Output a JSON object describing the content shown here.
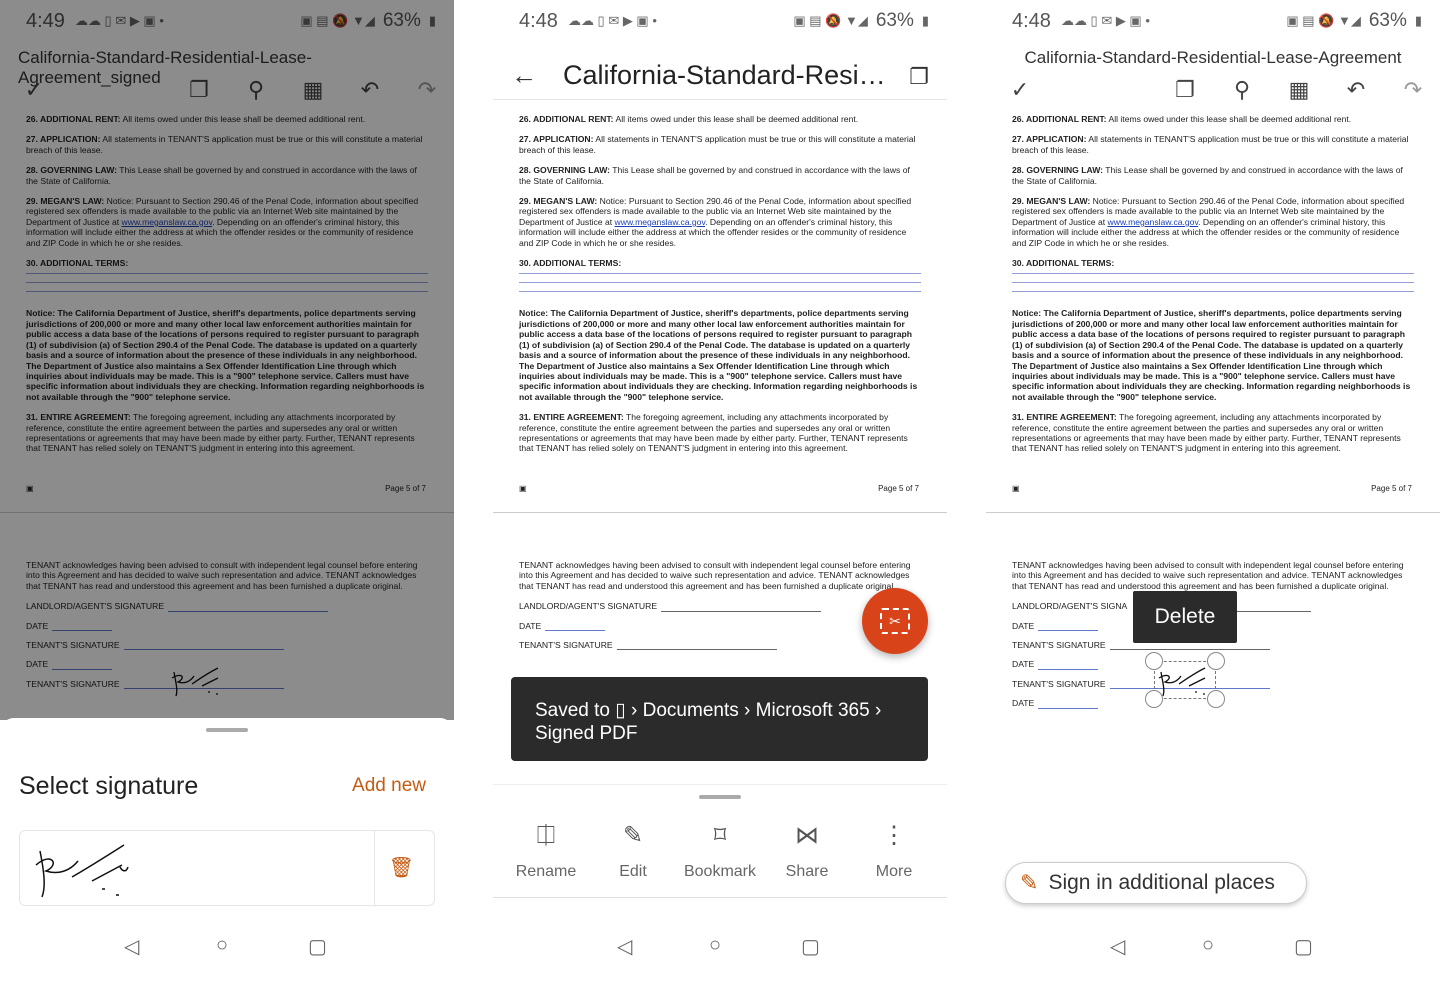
{
  "status": {
    "panel1_time": "4:49",
    "panel2_time": "4:48",
    "panel3_time": "4:48",
    "battery": "63%"
  },
  "panel1": {
    "title": "California-Standard-Residential-Lease-Agreement_signed",
    "sheet_title": "Select signature",
    "add_new": "Add new"
  },
  "panel2": {
    "title": "California-Standard-Resi…",
    "toast_line1": "Saved to",
    "toast_path": "› Documents › Microsoft 365 ›",
    "toast_line2": "Signed PDF",
    "actions": [
      "Rename",
      "Edit",
      "Bookmark",
      "Share",
      "More"
    ]
  },
  "panel3": {
    "title": "California-Standard-Residential-Lease-Agreement",
    "delete_label": "Delete",
    "sign_more": "Sign in additional places"
  },
  "doc": {
    "c26_h": "26. ADDITIONAL RENT:",
    "c26": " All items owed under this lease shall be deemed additional rent.",
    "c27_h": "27. APPLICATION:",
    "c27": " All statements in TENANT'S application must be true or this will constitute a material breach of this lease.",
    "c28_h": "28. GOVERNING LAW:",
    "c28": " This Lease shall be governed by and construed in accordance with the laws of the State of California.",
    "c29_h": "29. MEGAN'S LAW:",
    "c29a": " Notice: Pursuant to Section 290.46 of the Penal Code, information about specified registered sex offenders is made available to the public via an Internet Web site maintained by the Department of Justice at ",
    "c29_link": "www.meganslaw.ca.gov",
    "c29b": ". Depending on an offender's criminal history, this information will include either the address at which the offender resides or the community of residence and ZIP Code in which he or she resides.",
    "c30_h": "30. ADDITIONAL TERMS:",
    "notice": "Notice: The California Department of Justice, sheriff's departments, police departments serving jurisdictions of 200,000 or more and many other local law enforcement authorities maintain for public access a data base of the locations of persons required to register pursuant to paragraph (1) of subdivision (a) of Section 290.4 of the Penal Code. The database is updated on a quarterly basis and a source of information about the presence of these individuals in any neighborhood. The Department of Justice also maintains a Sex Offender Identification Line through which inquiries about individuals may be made. This is a \"900\" telephone service. Callers must have specific information about individuals they are checking. Information regarding neighborhoods is not available through the \"900\" telephone service.",
    "c31_h": "31. ENTIRE AGREEMENT:",
    "c31": " The foregoing agreement, including any attachments incorporated by reference, constitute the entire agreement between the parties and supersedes any oral or written representations or agreements that may have been made by either party. Further, TENANT represents that TENANT has relied solely on TENANT'S judgment in entering into this agreement.",
    "page_label": "Page 5 of 7",
    "ack": "TENANT acknowledges having been advised to consult with independent legal counsel before entering into this Agreement and has decided to waive such representation and advice. TENANT acknowledges that TENANT has read and understood this agreement and has been furnished a duplicate original.",
    "landlord_sig": "LANDLORD/AGENT'S SIGNATURE",
    "landlord_sig_short": "LANDLORD/AGENT'S SIGNA",
    "date": "DATE",
    "tenant_sig": "TENANT'S SIGNATURE"
  },
  "colors": {
    "accent": "#c55a11",
    "fab": "#d9431a",
    "toast_bg": "#2b2b2b",
    "link": "#1a3fb5"
  },
  "icons": [
    "check-icon",
    "copy-icon",
    "search-icon",
    "grid-icon",
    "undo-icon",
    "redo-icon",
    "back-arrow-icon",
    "trash-icon",
    "pen-icon",
    "phone-icon"
  ]
}
